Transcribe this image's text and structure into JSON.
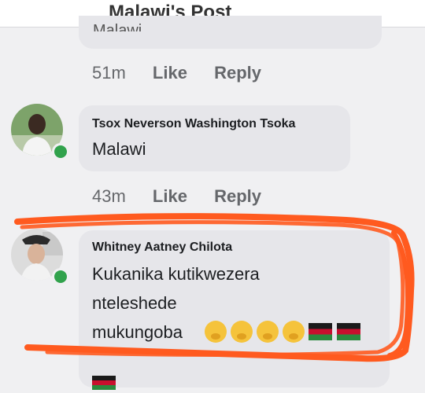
{
  "header": {
    "title": "Malawi's Post"
  },
  "previous_comment": {
    "text_fragment": "Malawi.",
    "time": "51m",
    "like_label": "Like",
    "reply_label": "Reply"
  },
  "comments": [
    {
      "author": "Tsox Neverson Washington Tsoka",
      "text": "Malawi",
      "time": "43m",
      "like_label": "Like",
      "reply_label": "Reply"
    },
    {
      "author": "Whitney Aatney Chilota",
      "text_lines": [
        "Kukanika kutikwezera",
        "nteleshede",
        "mukungoba"
      ],
      "emojis": [
        "thinking-face",
        "thinking-face",
        "thinking-face",
        "thinking-face"
      ],
      "flags": [
        "malawi-flag",
        "malawi-flag"
      ]
    }
  ],
  "colors": {
    "online": "#31a24c",
    "bubble": "#e6e6ea",
    "annotation": "#ff5a1f"
  }
}
